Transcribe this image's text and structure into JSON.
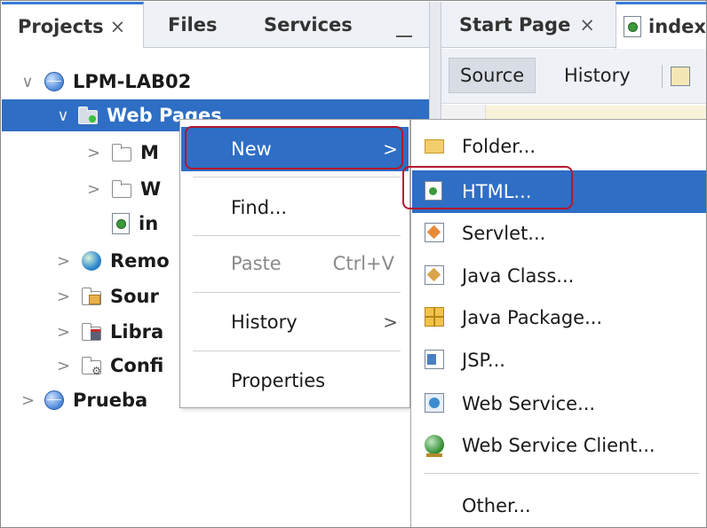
{
  "left_panel": {
    "tabs": [
      {
        "label": "Projects",
        "close": "×"
      },
      {
        "label": "Files"
      },
      {
        "label": "Services"
      }
    ]
  },
  "editor": {
    "tabs": [
      {
        "label": "Start Page",
        "close": "×"
      },
      {
        "label": "index"
      }
    ],
    "toolbar": {
      "source": "Source",
      "history": "History"
    }
  },
  "tree": [
    {
      "label": "LPM-LAB02",
      "icon": "globe-icon",
      "chevron": "∨"
    },
    {
      "label": "Web Pages",
      "icon": "web-folder-icon",
      "chevron": "∨",
      "selected": true
    },
    {
      "label": "M",
      "icon": "folder-icon",
      "chevron": ">"
    },
    {
      "label": "W",
      "icon": "folder-icon",
      "chevron": ">"
    },
    {
      "label": "in",
      "icon": "html-file-icon"
    },
    {
      "label": "Remo",
      "icon": "remote-files-icon",
      "chevron": ">"
    },
    {
      "label": "Sour",
      "icon": "source-folder-icon",
      "chevron": ">"
    },
    {
      "label": "Libra",
      "icon": "library-folder-icon",
      "chevron": ">"
    },
    {
      "label": "Confi",
      "icon": "config-folder-icon",
      "chevron": ">"
    },
    {
      "label": "Prueba",
      "icon": "globe-icon",
      "chevron": ">"
    }
  ],
  "context_menu": {
    "new": "New",
    "find": "Find...",
    "paste": "Paste",
    "paste_shortcut": "Ctrl+V",
    "history": "History",
    "properties": "Properties",
    "submenu_arrow": ">"
  },
  "new_submenu": [
    {
      "label": "Folder...",
      "icon": "folder-icon"
    },
    {
      "label": "HTML...",
      "icon": "html-file-icon"
    },
    {
      "label": "Servlet...",
      "icon": "servlet-icon"
    },
    {
      "label": "Java Class...",
      "icon": "java-class-icon"
    },
    {
      "label": "Java Package...",
      "icon": "java-package-icon"
    },
    {
      "label": "JSP...",
      "icon": "jsp-icon"
    },
    {
      "label": "Web Service...",
      "icon": "web-service-icon"
    },
    {
      "label": "Web Service Client...",
      "icon": "web-service-client-icon"
    },
    {
      "label": "Other..."
    }
  ],
  "colors": {
    "selection": "#2e6ec4",
    "highlight_box": "#b5172e",
    "tab_accent": "#3a7ad6"
  }
}
